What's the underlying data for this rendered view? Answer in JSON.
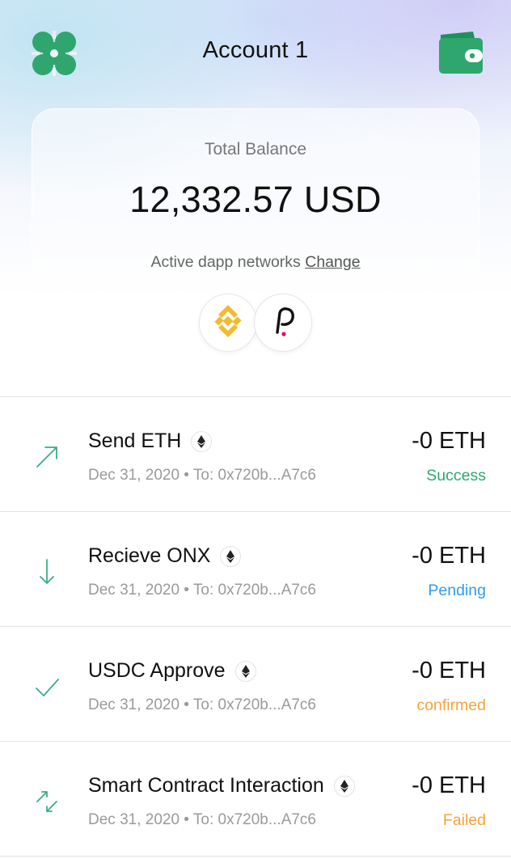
{
  "header": {
    "title": "Account 1",
    "logo_icon": "clover-logo-icon",
    "wallet_icon": "wallet-icon"
  },
  "balance": {
    "label": "Total Balance",
    "amount": "12,332.57 USD",
    "networks_label": "Active dapp networks",
    "change_link": "Change",
    "networks": [
      {
        "name": "Binance",
        "icon": "binance-icon",
        "color": "#F3BA2F"
      },
      {
        "name": "Polkadot",
        "icon": "polkadot-icon",
        "color": "#E6007A"
      }
    ]
  },
  "colors": {
    "brand_green": "#2FA66E",
    "success": "#2FA66E",
    "pending": "#2F9BF0",
    "confirmed": "#F5A33A",
    "failed": "#F5A33A"
  },
  "transactions": [
    {
      "title": "Send ETH",
      "icon": "send-arrow-icon",
      "meta": "Dec 31, 2020 • To: 0x720b...A7c6",
      "amount": "-0 ETH",
      "status": "Success"
    },
    {
      "title": "Recieve ONX",
      "icon": "receive-arrow-icon",
      "meta": "Dec 31, 2020 • To: 0x720b...A7c6",
      "amount": "-0 ETH",
      "status": "Pending"
    },
    {
      "title": "USDC Approve",
      "icon": "checkmark-icon",
      "meta": "Dec 31, 2020 • To: 0x720b...A7c6",
      "amount": "-0 ETH",
      "status": "confirmed"
    },
    {
      "title": "Smart Contract Interaction",
      "icon": "contract-swap-icon",
      "meta": "Dec 31, 2020 • To: 0x720b...A7c6",
      "amount": "-0 ETH",
      "status": "Failed"
    }
  ]
}
